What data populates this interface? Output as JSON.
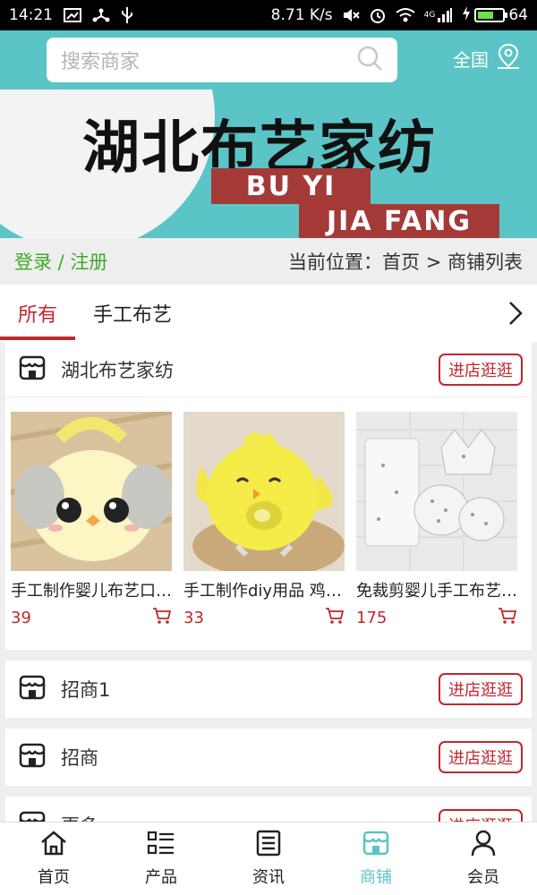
{
  "statusbar": {
    "time": "14:21",
    "speed": "8.71 K/s",
    "network": "4G",
    "battery": "64",
    "battery_level": 0.64
  },
  "header": {
    "search_placeholder": "搜索商家",
    "region_label": "全国"
  },
  "banner": {
    "title": "湖北布艺家纺",
    "line1": "BU YI",
    "line2": "JIA FANG"
  },
  "breadcrumb": {
    "login_label": "登录 / 注册",
    "location": "当前位置：首页 > 商铺列表"
  },
  "tabs": [
    {
      "label": "所有"
    },
    {
      "label": "手工布艺"
    }
  ],
  "shops": [
    {
      "name": "湖北布艺家纺",
      "visit_label": "进店逛逛",
      "products": [
        {
          "name": "手工制作婴儿布艺口水巾",
          "price": "39"
        },
        {
          "name": "手工制作diy用品 鸡仔枕",
          "price": "33"
        },
        {
          "name": "免裁剪婴儿手工布艺套装",
          "price": "175"
        }
      ]
    },
    {
      "name": "招商1",
      "visit_label": "进店逛逛"
    },
    {
      "name": "招商",
      "visit_label": "进店逛逛"
    },
    {
      "name": "更多",
      "visit_label": "进店逛逛"
    }
  ],
  "bottomnav": [
    {
      "label": "首页",
      "icon": "home-icon"
    },
    {
      "label": "产品",
      "icon": "list-icon"
    },
    {
      "label": "资讯",
      "icon": "news-icon"
    },
    {
      "label": "商铺",
      "icon": "store-icon"
    },
    {
      "label": "会员",
      "icon": "user-icon"
    }
  ],
  "colors": {
    "teal": "#5bc4c7",
    "accent": "#c1272d",
    "green": "#3faa2c"
  }
}
